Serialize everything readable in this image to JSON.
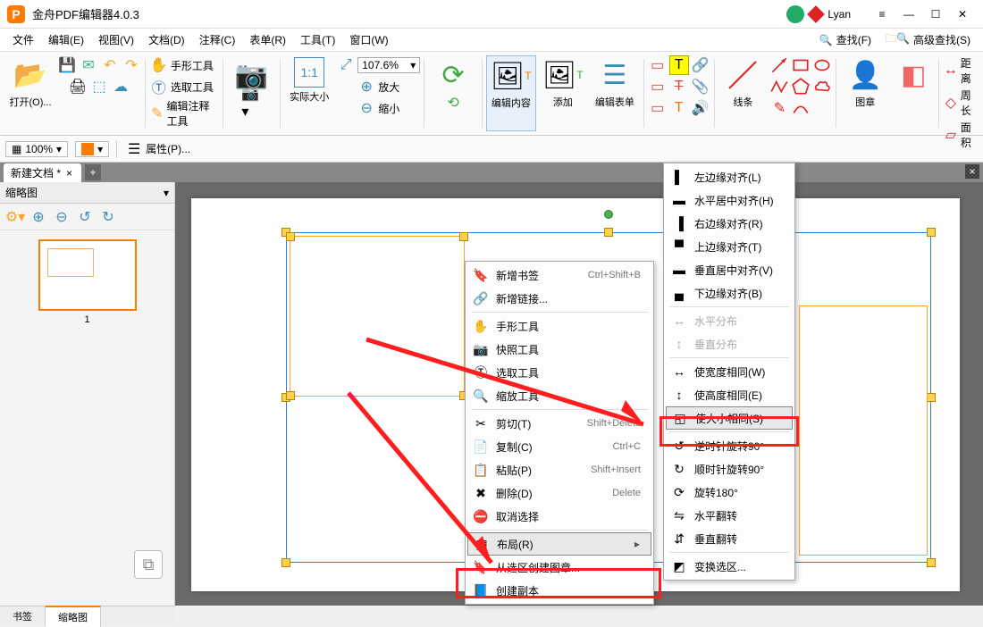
{
  "app": {
    "title": "金舟PDF编辑器4.0.3",
    "logo_letter": "P",
    "user": "Lyan"
  },
  "menubar": {
    "items": [
      "文件",
      "编辑(E)",
      "视图(V)",
      "文档(D)",
      "注释(C)",
      "表单(R)",
      "工具(T)",
      "窗口(W)"
    ],
    "search": "查找(F)",
    "adv_search": "高级查找(S)"
  },
  "ribbon": {
    "open": "打开(O)...",
    "hand_tool": "手形工具",
    "select_tool": "选取工具",
    "edit_annot": "编辑注释工具",
    "actual_size": "实际大小",
    "zoom_value": "107.6%",
    "zoom_in": "放大",
    "zoom_out": "缩小",
    "edit_content": "编辑内容",
    "add": "添加",
    "edit_form": "编辑表单",
    "line": "线条",
    "stamp": "图章",
    "distance": "距离",
    "perimeter": "周长",
    "area": "面积"
  },
  "optbar": {
    "zoom": "100%",
    "props": "属性(P)..."
  },
  "tab": {
    "name": "新建文档 *"
  },
  "side": {
    "header": "缩略图",
    "thumb_label": "1",
    "bottom_tabs": [
      "书签",
      "缩略图"
    ]
  },
  "context_menu": [
    {
      "icon": "🔖",
      "label": "新增书签",
      "shortcut": "Ctrl+Shift+B"
    },
    {
      "icon": "🔗",
      "label": "新增链接..."
    },
    {
      "sep": true
    },
    {
      "icon": "✋",
      "label": "手形工具"
    },
    {
      "icon": "📷",
      "label": "快照工具"
    },
    {
      "icon": "Ⓣ",
      "label": "选取工具"
    },
    {
      "icon": "🔍",
      "label": "缩放工具"
    },
    {
      "sep": true
    },
    {
      "icon": "✂",
      "label": "剪切(T)",
      "shortcut": "Shift+Delete"
    },
    {
      "icon": "📄",
      "label": "复制(C)",
      "shortcut": "Ctrl+C"
    },
    {
      "icon": "📋",
      "label": "粘贴(P)",
      "shortcut": "Shift+Insert"
    },
    {
      "icon": "✖",
      "label": "删除(D)",
      "shortcut": "Delete"
    },
    {
      "icon": "⛔",
      "label": "取消选择"
    },
    {
      "sep": true
    },
    {
      "icon": "▦",
      "label": "布局(R)",
      "submenu": true,
      "highlight": true
    },
    {
      "icon": "🔖",
      "label": "从选区创建图章..."
    },
    {
      "icon": "📘",
      "label": "创建副本"
    }
  ],
  "layout_submenu": [
    {
      "icon": "▌",
      "label": "左边缘对齐(L)"
    },
    {
      "icon": "▬",
      "label": "水平居中对齐(H)"
    },
    {
      "icon": "▐",
      "label": "右边缘对齐(R)"
    },
    {
      "icon": "▀",
      "label": "上边缘对齐(T)"
    },
    {
      "icon": "▬",
      "label": "垂直居中对齐(V)"
    },
    {
      "icon": "▄",
      "label": "下边缘对齐(B)"
    },
    {
      "sep": true
    },
    {
      "icon": "↔",
      "label": "水平分布",
      "disabled": true
    },
    {
      "icon": "↕",
      "label": "垂直分布",
      "disabled": true
    },
    {
      "sep": true
    },
    {
      "icon": "↔",
      "label": "使宽度相同(W)"
    },
    {
      "icon": "↕",
      "label": "使高度相同(E)"
    },
    {
      "icon": "◱",
      "label": "使大小相同(S)",
      "highlight": true
    },
    {
      "sep": true
    },
    {
      "icon": "↺",
      "label": "逆时针旋转90°"
    },
    {
      "icon": "↻",
      "label": "顺时针旋转90°"
    },
    {
      "icon": "⟳",
      "label": "旋转180°"
    },
    {
      "icon": "⇋",
      "label": "水平翻转"
    },
    {
      "icon": "⇵",
      "label": "垂直翻转"
    },
    {
      "sep": true
    },
    {
      "icon": "◩",
      "label": "变换选区..."
    }
  ]
}
